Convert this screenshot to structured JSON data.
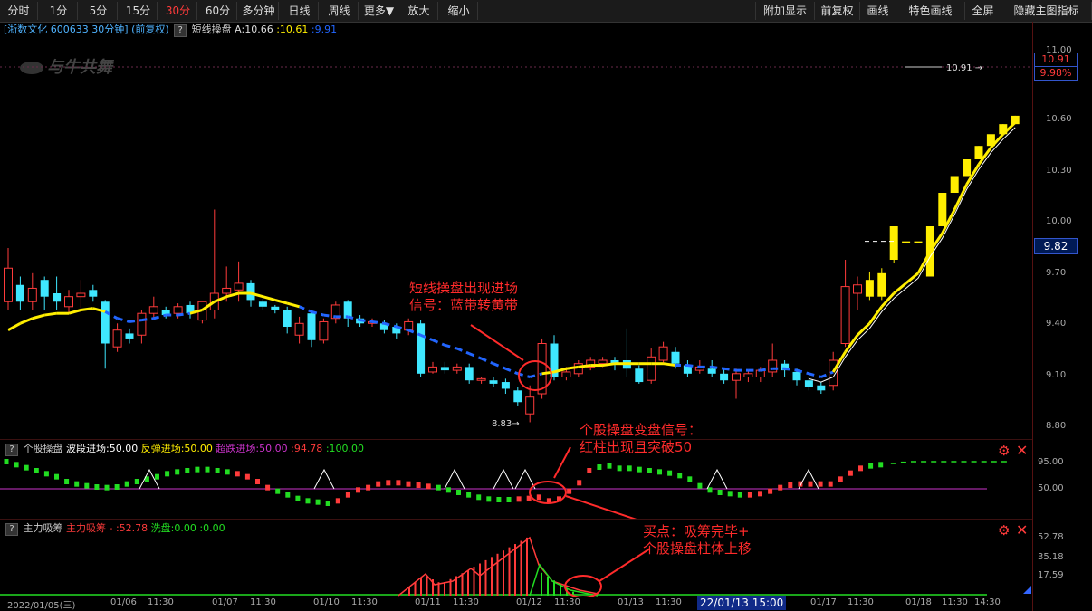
{
  "toolbar": {
    "left": [
      "分时",
      "1分",
      "5分",
      "15分",
      "30分",
      "60分",
      "多分钟",
      "日线",
      "周线",
      "更多▼",
      "放大",
      "缩小"
    ],
    "active": "30分",
    "right": [
      "附加显示",
      "前复权",
      "画线",
      "特色画线",
      "全屏",
      "隐藏主图指标"
    ]
  },
  "info": {
    "stock": "[浙数文化 600633 30分钟]",
    "adj": "(前复权)",
    "indicator": "短线操盘",
    "a_val": "A:10.66",
    "b_val": ":10.61",
    "c_val": ":9.91"
  },
  "watermark": "与牛共舞",
  "price_axis": [
    "11.00",
    "10.60",
    "10.30",
    "10.00",
    "9.70",
    "9.40",
    "9.10",
    "8.80"
  ],
  "price_box_top": "10.91",
  "price_box_pct": "9.98%",
  "price_box_cur": "9.82",
  "marker_high": "10.91",
  "marker_low": "8.83",
  "ind1": {
    "name": "个股操盘",
    "l1": "波段进场:50.00",
    "l2": "反弹进场:50.00",
    "l3": "超跌进场:50.00",
    "l4": ":94.78",
    "l5": ":100.00",
    "axis": [
      "95.00",
      "50.00"
    ]
  },
  "ind2": {
    "name": "主力吸筹",
    "l1": "主力吸筹 - :52.78",
    "l2": "洗盘:0.00",
    "l3": ":0.00",
    "axis": [
      "52.78",
      "35.18",
      "17.59"
    ]
  },
  "annotations": {
    "a1_line1": "短线操盘出现进场",
    "a1_line2": "信号：蓝带转黄带",
    "a2_line1": "个股操盘变盘信号：",
    "a2_line2": "红柱出现且突破50",
    "a3_line1": "买点：吸筹完毕+",
    "a3_line2": "个股操盘柱体上移"
  },
  "time_axis": [
    "2022/01/05(三)",
    "01/06",
    "11:30",
    "01/07",
    "11:30",
    "01/10",
    "11:30",
    "01/11",
    "11:30",
    "01/12",
    "11:30",
    "01/13",
    "11:30",
    "01/17",
    "11:30",
    "01/18",
    "11:30",
    "14:30"
  ],
  "cursor_time": "22/01/13 15:00",
  "colors": {
    "up": "#ff3b3b",
    "down": "#3fe7ff",
    "yellow": "#ffee00",
    "blue": "#2266ff",
    "green": "#22dd22",
    "magenta": "#cc33cc"
  }
}
